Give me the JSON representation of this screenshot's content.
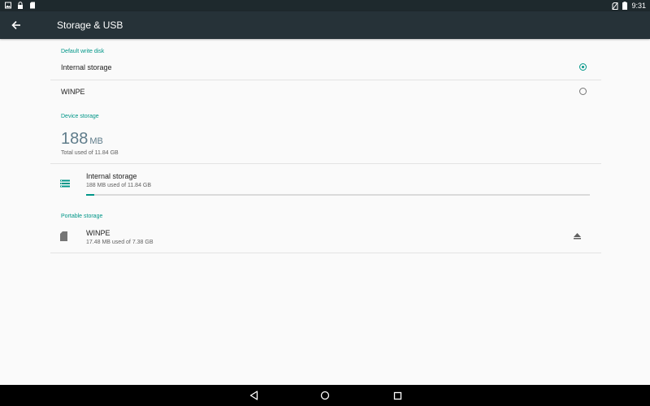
{
  "status_bar": {
    "left_icons": [
      "gallery-notification-icon",
      "lock-notification-icon",
      "sd-card-notification-icon"
    ],
    "right_icons": [
      "no-sim-icon",
      "battery-icon"
    ],
    "time": "9:31"
  },
  "toolbar": {
    "title": "Storage & USB",
    "back_icon": "arrow-back-icon"
  },
  "default_write_disk": {
    "header": "Default write disk",
    "options": [
      {
        "label": "Internal storage",
        "selected": true
      },
      {
        "label": "WINPE",
        "selected": false
      }
    ]
  },
  "device_storage": {
    "header": "Device storage",
    "used_value": "188",
    "used_unit": "MB",
    "total_summary": "Total used of 11.84 GB",
    "volume": {
      "title": "Internal storage",
      "summary": "188 MB used of 11.84 GB",
      "icon": "storage-icon",
      "used_fraction": 0.016
    }
  },
  "portable_storage": {
    "header": "Portable storage",
    "volume": {
      "title": "WINPE",
      "summary": "17.48 MB used of 7.38 GB",
      "icon": "sd-card-icon",
      "action_icon": "eject-icon"
    }
  },
  "nav_bar": {
    "buttons": [
      "back-triangle-icon",
      "home-circle-icon",
      "recents-square-icon"
    ]
  },
  "colors": {
    "accent": "#009688",
    "toolbar": "#263238",
    "status_bar": "#1e292d",
    "big_number": "#607d8b"
  }
}
